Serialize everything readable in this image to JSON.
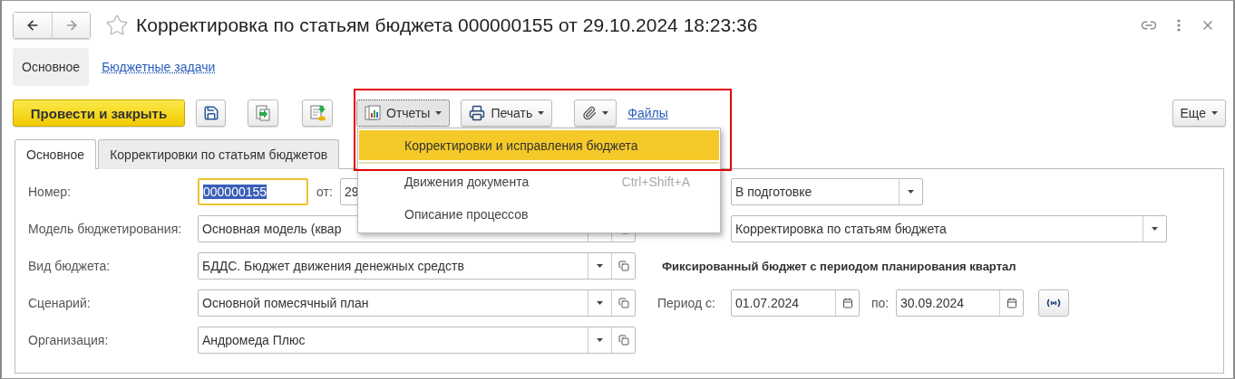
{
  "window": {
    "title": "Корректировка по статьям бюджета 000000155 от 29.10.2024 18:23:36",
    "favorite": false
  },
  "sections": [
    {
      "label": "Основное",
      "selected": true
    },
    {
      "label": "Бюджетные задачи",
      "selected": false
    }
  ],
  "toolbar": {
    "primary": "Провести и закрыть",
    "reports": "Отчеты",
    "reports_open": true,
    "print": "Печать",
    "files": "Файлы",
    "more": "Еще"
  },
  "tabs": [
    {
      "label": "Основное",
      "selected": true
    },
    {
      "label": "Корректировки по статьям бюджетов",
      "selected": false
    }
  ],
  "menu": {
    "items": [
      {
        "label": "Корректировки и исправления бюджета",
        "selected": true
      },
      {
        "label": "Движения документа",
        "shortcut": "Ctrl+Shift+A",
        "selected": false
      },
      {
        "label": "Описание процессов",
        "selected": false
      }
    ]
  },
  "form": {
    "number_label": "Номер:",
    "number": "000000155",
    "number_focused": true,
    "date_label": "от:",
    "date": "29",
    "fields": [
      {
        "label": "Модель бюджетирования:",
        "value": "Основная модель (квар"
      },
      {
        "label": "Вид бюджета:",
        "value": "БДДС. Бюджет движения денежных средств"
      },
      {
        "label": "Сценарий:",
        "value": "Основной помесячный план"
      },
      {
        "label": "Организация:",
        "value": "Андромеда Плюс"
      }
    ],
    "status": "В подготовке",
    "operation": "Корректировка по статьям бюджета",
    "note": "Фиксированный бюджет с периодом планирования квартал",
    "period_from_label": "Период с:",
    "period_from": "01.07.2024",
    "period_to_label": "по:",
    "period_to": "30.09.2024"
  }
}
